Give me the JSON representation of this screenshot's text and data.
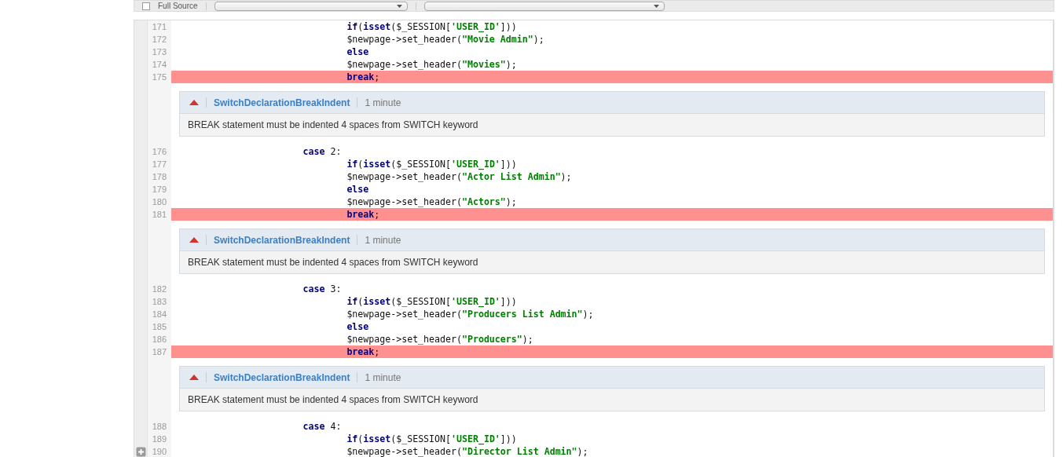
{
  "toolbar": {
    "full_source": {
      "label": "Full Source",
      "checked": false
    }
  },
  "rows": [
    {
      "kind": "code",
      "number": "171",
      "flagged": false,
      "expandable": false,
      "tokens": [
        {
          "kind": "keyword",
          "text": "\t\t\t\t\t\t\t\tif"
        },
        {
          "kind": "plain",
          "text": "("
        },
        {
          "kind": "keyword",
          "text": "isset"
        },
        {
          "kind": "plain",
          "text": "($_SESSION["
        },
        {
          "kind": "string",
          "text": "'USER_ID'"
        },
        {
          "kind": "plain",
          "text": "]))"
        }
      ]
    },
    {
      "kind": "code",
      "number": "172",
      "flagged": false,
      "expandable": false,
      "tokens": [
        {
          "kind": "plain",
          "text": "\t\t\t\t\t\t\t\t$newpage->set_header("
        },
        {
          "kind": "string",
          "text": "\"Movie Admin\""
        },
        {
          "kind": "plain",
          "text": ");"
        }
      ]
    },
    {
      "kind": "code",
      "number": "173",
      "flagged": false,
      "expandable": false,
      "tokens": [
        {
          "kind": "keyword",
          "text": "\t\t\t\t\t\t\t\telse"
        }
      ]
    },
    {
      "kind": "code",
      "number": "174",
      "flagged": false,
      "expandable": false,
      "tokens": [
        {
          "kind": "plain",
          "text": "\t\t\t\t\t\t\t\t$newpage->set_header("
        },
        {
          "kind": "string",
          "text": "\"Movies\""
        },
        {
          "kind": "plain",
          "text": ");"
        }
      ]
    },
    {
      "kind": "code",
      "number": "175",
      "flagged": true,
      "expandable": false,
      "tokens": [
        {
          "kind": "keyword",
          "text": "\t\t\t\t\t\t\t\tbreak"
        },
        {
          "kind": "plain",
          "text": ";"
        }
      ]
    },
    {
      "kind": "issue",
      "rule": "SwitchDeclarationBreakIndent",
      "age": "1 minute",
      "message": "BREAK statement must be indented 4 spaces from SWITCH keyword"
    },
    {
      "kind": "code",
      "number": "176",
      "flagged": false,
      "expandable": false,
      "tokens": [
        {
          "kind": "keyword",
          "text": "\t\t\t\t\t\tcase"
        },
        {
          "kind": "plain",
          "text": " 2:"
        }
      ]
    },
    {
      "kind": "code",
      "number": "177",
      "flagged": false,
      "expandable": false,
      "tokens": [
        {
          "kind": "keyword",
          "text": "\t\t\t\t\t\t\t\tif"
        },
        {
          "kind": "plain",
          "text": "("
        },
        {
          "kind": "keyword",
          "text": "isset"
        },
        {
          "kind": "plain",
          "text": "($_SESSION["
        },
        {
          "kind": "string",
          "text": "'USER_ID'"
        },
        {
          "kind": "plain",
          "text": "]))"
        }
      ]
    },
    {
      "kind": "code",
      "number": "178",
      "flagged": false,
      "expandable": false,
      "tokens": [
        {
          "kind": "plain",
          "text": "\t\t\t\t\t\t\t\t$newpage->set_header("
        },
        {
          "kind": "string",
          "text": "\"Actor List Admin\""
        },
        {
          "kind": "plain",
          "text": ");"
        }
      ]
    },
    {
      "kind": "code",
      "number": "179",
      "flagged": false,
      "expandable": false,
      "tokens": [
        {
          "kind": "keyword",
          "text": "\t\t\t\t\t\t\t\telse"
        }
      ]
    },
    {
      "kind": "code",
      "number": "180",
      "flagged": false,
      "expandable": false,
      "tokens": [
        {
          "kind": "plain",
          "text": "\t\t\t\t\t\t\t\t$newpage->set_header("
        },
        {
          "kind": "string",
          "text": "\"Actors\""
        },
        {
          "kind": "plain",
          "text": ");"
        }
      ]
    },
    {
      "kind": "code",
      "number": "181",
      "flagged": true,
      "expandable": false,
      "tokens": [
        {
          "kind": "keyword",
          "text": "\t\t\t\t\t\t\t\tbreak"
        },
        {
          "kind": "plain",
          "text": ";"
        }
      ]
    },
    {
      "kind": "issue",
      "rule": "SwitchDeclarationBreakIndent",
      "age": "1 minute",
      "message": "BREAK statement must be indented 4 spaces from SWITCH keyword"
    },
    {
      "kind": "code",
      "number": "182",
      "flagged": false,
      "expandable": false,
      "tokens": [
        {
          "kind": "keyword",
          "text": "\t\t\t\t\t\tcase"
        },
        {
          "kind": "plain",
          "text": " 3:"
        }
      ]
    },
    {
      "kind": "code",
      "number": "183",
      "flagged": false,
      "expandable": false,
      "tokens": [
        {
          "kind": "keyword",
          "text": "\t\t\t\t\t\t\t\tif"
        },
        {
          "kind": "plain",
          "text": "("
        },
        {
          "kind": "keyword",
          "text": "isset"
        },
        {
          "kind": "plain",
          "text": "($_SESSION["
        },
        {
          "kind": "string",
          "text": "'USER_ID'"
        },
        {
          "kind": "plain",
          "text": "]))"
        }
      ]
    },
    {
      "kind": "code",
      "number": "184",
      "flagged": false,
      "expandable": false,
      "tokens": [
        {
          "kind": "plain",
          "text": "\t\t\t\t\t\t\t\t$newpage->set_header("
        },
        {
          "kind": "string",
          "text": "\"Producers List Admin\""
        },
        {
          "kind": "plain",
          "text": ");"
        }
      ]
    },
    {
      "kind": "code",
      "number": "185",
      "flagged": false,
      "expandable": false,
      "tokens": [
        {
          "kind": "keyword",
          "text": "\t\t\t\t\t\t\t\telse"
        }
      ]
    },
    {
      "kind": "code",
      "number": "186",
      "flagged": false,
      "expandable": false,
      "tokens": [
        {
          "kind": "plain",
          "text": "\t\t\t\t\t\t\t\t$newpage->set_header("
        },
        {
          "kind": "string",
          "text": "\"Producers\""
        },
        {
          "kind": "plain",
          "text": ");"
        }
      ]
    },
    {
      "kind": "code",
      "number": "187",
      "flagged": true,
      "expandable": false,
      "tokens": [
        {
          "kind": "keyword",
          "text": "\t\t\t\t\t\t\t\tbreak"
        },
        {
          "kind": "plain",
          "text": ";"
        }
      ]
    },
    {
      "kind": "issue",
      "rule": "SwitchDeclarationBreakIndent",
      "age": "1 minute",
      "message": "BREAK statement must be indented 4 spaces from SWITCH keyword"
    },
    {
      "kind": "code",
      "number": "188",
      "flagged": false,
      "expandable": false,
      "tokens": [
        {
          "kind": "keyword",
          "text": "\t\t\t\t\t\tcase"
        },
        {
          "kind": "plain",
          "text": " 4:"
        }
      ]
    },
    {
      "kind": "code",
      "number": "189",
      "flagged": false,
      "expandable": false,
      "tokens": [
        {
          "kind": "keyword",
          "text": "\t\t\t\t\t\t\t\tif"
        },
        {
          "kind": "plain",
          "text": "("
        },
        {
          "kind": "keyword",
          "text": "isset"
        },
        {
          "kind": "plain",
          "text": "($_SESSION["
        },
        {
          "kind": "string",
          "text": "'USER_ID'"
        },
        {
          "kind": "plain",
          "text": "]))"
        }
      ]
    },
    {
      "kind": "code",
      "number": "190",
      "flagged": false,
      "expandable": true,
      "tokens": [
        {
          "kind": "plain",
          "text": "\t\t\t\t\t\t\t\t$newpage->set_header("
        },
        {
          "kind": "string",
          "text": "\"Director List Admin\""
        },
        {
          "kind": "plain",
          "text": ");"
        }
      ]
    }
  ]
}
